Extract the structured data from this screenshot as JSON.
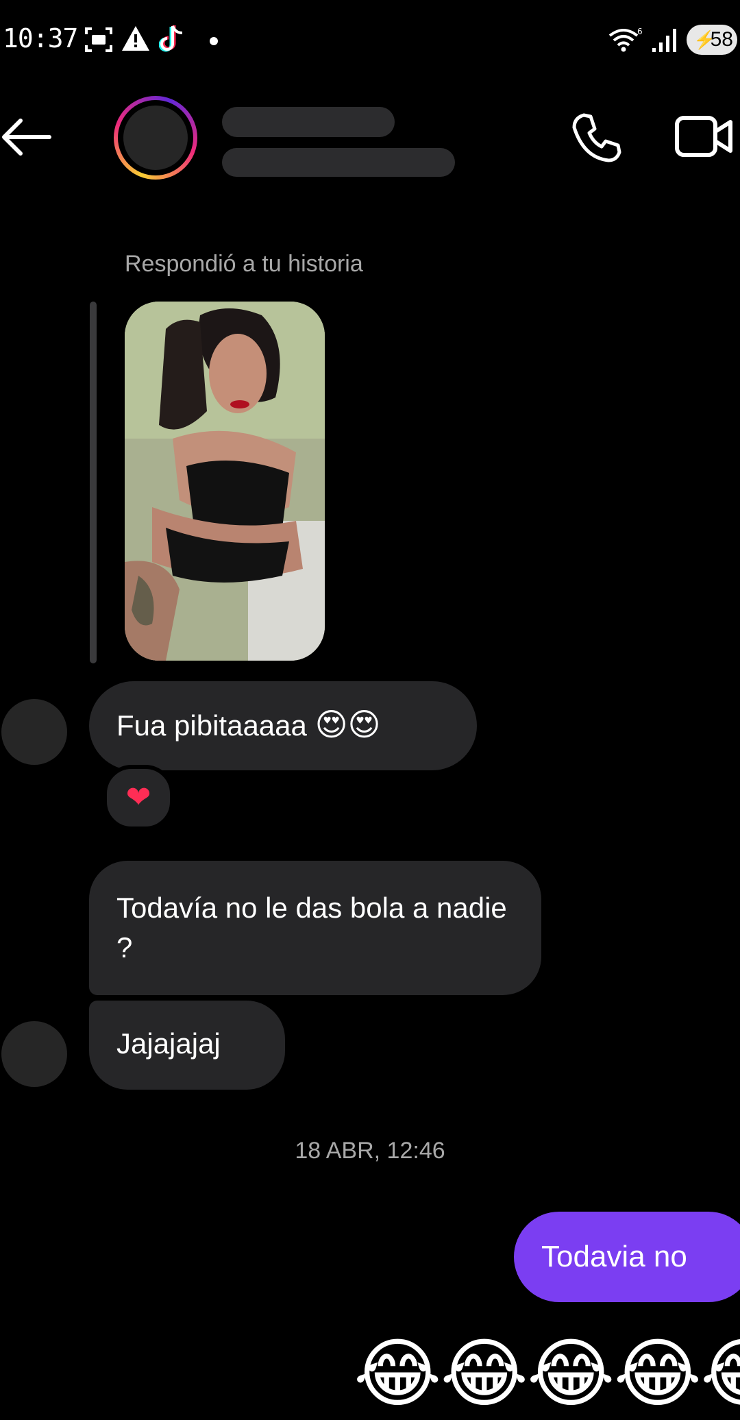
{
  "status_bar": {
    "time": "10:37",
    "battery": "58",
    "icons": [
      "screenshot-icon",
      "warning-icon",
      "tiktok-icon",
      "wifi-icon",
      "signal-icon",
      "battery-icon"
    ]
  },
  "header": {
    "icons": [
      "back-arrow-icon",
      "phone-icon",
      "video-camera-icon"
    ]
  },
  "story_reply": {
    "label": "Respondió a tu historia"
  },
  "messages": {
    "m1": {
      "text": "Fua pibitaaaaa",
      "emoji": "😍😍"
    },
    "reaction": "❤",
    "m2": {
      "text": "Todavía no le das bola a nadie ?"
    },
    "m3": {
      "text": "Jajajajaj"
    },
    "timestamp": "18 ABR, 12:46",
    "sent": {
      "text": "Todavia no"
    },
    "emoji_row": "😂😂😂😂😂"
  },
  "colors": {
    "background": "#000000",
    "received_bubble": "#262628",
    "sent_bubble": "#7b3ef2",
    "muted_text": "#a8a8a8"
  }
}
